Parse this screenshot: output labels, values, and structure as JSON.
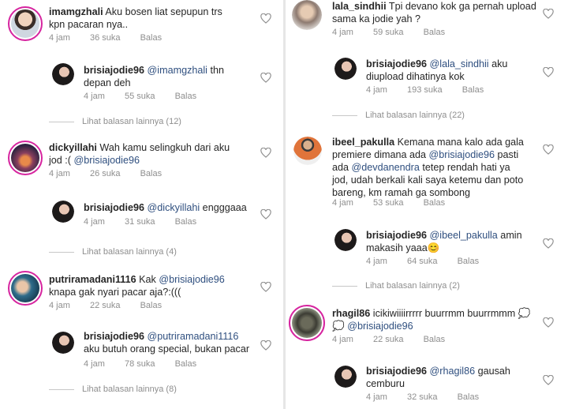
{
  "ui": {
    "reply_label": "Balas"
  },
  "left": [
    {
      "user": "imamgzhali",
      "text_lines": [
        "Aku bosen liat sepupun trs",
        "kpn pacaran nya.."
      ],
      "time": "4 jam",
      "likes": "36 suka"
    },
    {
      "user": "brisiajodie96",
      "mention": "@imamgzhali",
      "text_lines": [
        " thn",
        "depan deh"
      ],
      "time": "4 jam",
      "likes": "55 suka"
    },
    {
      "more": "Lihat balasan lainnya (12)"
    },
    {
      "user": "dickyillahi",
      "text_lines": [
        "Wah kamu selingkuh dari aku",
        "jod :( "
      ],
      "mention2": "@brisiajodie96",
      "time": "4 jam",
      "likes": "26 suka"
    },
    {
      "user": "brisiajodie96",
      "mention": "@dickyillahi",
      "text_lines": [
        " engggaaa"
      ],
      "time": "4 jam",
      "likes": "31 suka"
    },
    {
      "more": "Lihat balasan lainnya (4)"
    },
    {
      "user": "putriramadani1116",
      "text_lines": [
        "Kak ",
        "knapa gak nyari pacar aja?:((("
      ],
      "mention2": "@brisiajodie96",
      "time": "4 jam",
      "likes": "22 suka"
    },
    {
      "user": "brisiajodie96",
      "mention": "@putriramadani1116",
      "text_lines": [
        "aku butuh orang special, bukan pacar"
      ],
      "time": "4 jam",
      "likes": "78 suka"
    },
    {
      "more": "Lihat balasan lainnya (8)"
    }
  ],
  "right": [
    {
      "user": "lala_sindhii",
      "text_lines": [
        "Tpi devano kok ga pernah upload",
        "sama ka jodie yah ?"
      ],
      "time": "4 jam",
      "likes": "59 suka"
    },
    {
      "user": "brisiajodie96",
      "mention": "@lala_sindhii",
      "text_lines": [
        " aku",
        "diupload dihatinya kok"
      ],
      "time": "4 jam",
      "likes": "193 suka"
    },
    {
      "more": "Lihat balasan lainnya (22)"
    },
    {
      "user": "ibeel_pakulla",
      "text_lines": [
        "Kemana mana kalo ada gala",
        "premiere dimana ada ",
        " pasti",
        "ada ",
        " tetep rendah hati ya",
        "jod, udah berkali kali saya ketemu dan poto",
        "bareng, km ramah ga sombong"
      ],
      "mention_a": "@brisiajodie96",
      "mention_b": "@devdanendra",
      "time": "4 jam",
      "likes": "53 suka"
    },
    {
      "user": "brisiajodie96",
      "mention": "@ibeel_pakulla",
      "text_lines": [
        " amin",
        "makasih yaaa😊"
      ],
      "time": "4 jam",
      "likes": "64 suka"
    },
    {
      "more": "Lihat balasan lainnya (2)"
    },
    {
      "user": "rhagil86",
      "text_lines": [
        "icikiwiiiirrrrr buurrmm buurrmmm 💭",
        "💭 "
      ],
      "mention2": "@brisiajodie96",
      "time": "4 jam",
      "likes": "22 suka"
    },
    {
      "user": "brisiajodie96",
      "mention": "@rhagil86",
      "text_lines": [
        " gausah",
        "cemburu"
      ],
      "time": "4 jam",
      "likes": "32 suka"
    }
  ],
  "colors": {
    "mention": "#2f4f7f",
    "meta": "#8e8e8e",
    "ring": "#d6249f"
  },
  "icons": {
    "like": "heart-outline-icon"
  }
}
